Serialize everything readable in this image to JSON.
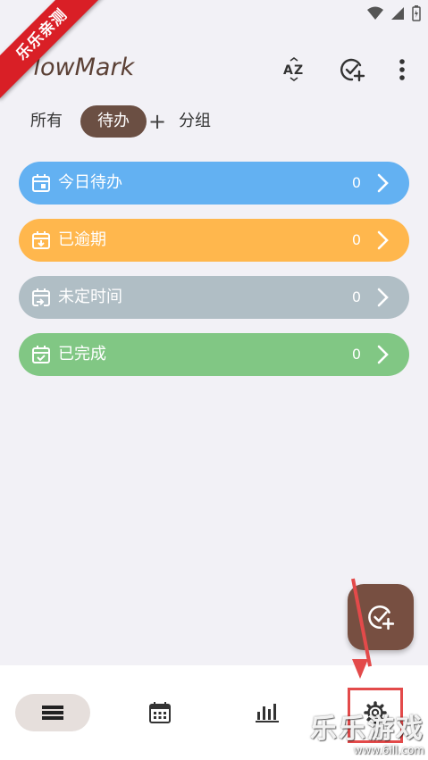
{
  "ribbon": {
    "text": "乐乐亲测"
  },
  "app": {
    "title": "FlowMark"
  },
  "tabs": [
    {
      "label": "所有"
    },
    {
      "label": "待办"
    },
    {
      "label": "分组"
    }
  ],
  "tab_add": "+",
  "categories": [
    {
      "label": "今日待办",
      "count": "0",
      "color": "#63b1f2",
      "icon": "calendar-today-icon"
    },
    {
      "label": "已逾期",
      "count": "0",
      "color": "#ffb74d",
      "icon": "calendar-overdue-icon"
    },
    {
      "label": "未定时间",
      "count": "0",
      "color": "#b0bec5",
      "icon": "calendar-unscheduled-icon"
    },
    {
      "label": "已完成",
      "count": "0",
      "color": "#81c784",
      "icon": "calendar-done-icon"
    }
  ],
  "nav": [
    {
      "icon": "list-icon"
    },
    {
      "icon": "calendar-icon"
    },
    {
      "icon": "bar-chart-icon"
    },
    {
      "icon": "settings-icon"
    }
  ],
  "watermark": {
    "main": "乐乐游戏",
    "url": "www.6ill.com"
  },
  "colors": {
    "accent": "#6b4f43",
    "fab": "#774f41",
    "annotation": "#e34a4a"
  }
}
